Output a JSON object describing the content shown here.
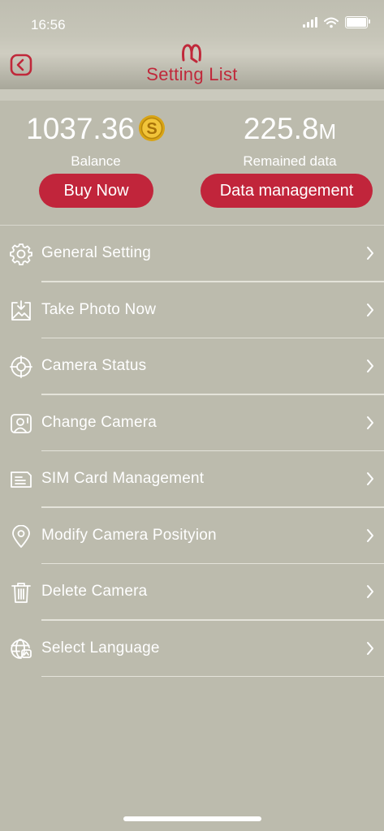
{
  "status_bar": {
    "time": "16:56"
  },
  "header": {
    "title": "Setting List"
  },
  "balance": {
    "value": "1037.36",
    "label": "Balance"
  },
  "data": {
    "value": "225.8",
    "unit": "M",
    "label": "Remained data"
  },
  "buttons": {
    "buy_now": "Buy Now",
    "data_management": "Data management"
  },
  "menu": {
    "items": [
      {
        "label": "General Setting",
        "icon": "gear-icon"
      },
      {
        "label": "Take Photo Now",
        "icon": "photo-download-icon"
      },
      {
        "label": "Camera Status",
        "icon": "crosshair-icon"
      },
      {
        "label": "Change Camera",
        "icon": "user-switch-icon"
      },
      {
        "label": "SIM Card Management",
        "icon": "sim-card-icon"
      },
      {
        "label": "Modify Camera Posityion",
        "icon": "location-pin-icon"
      },
      {
        "label": "Delete Camera",
        "icon": "trash-icon"
      },
      {
        "label": "Select Language",
        "icon": "globe-icon"
      }
    ]
  },
  "colors": {
    "accent": "#c1253b",
    "background": "#bcbbad",
    "text": "#ffffff"
  }
}
